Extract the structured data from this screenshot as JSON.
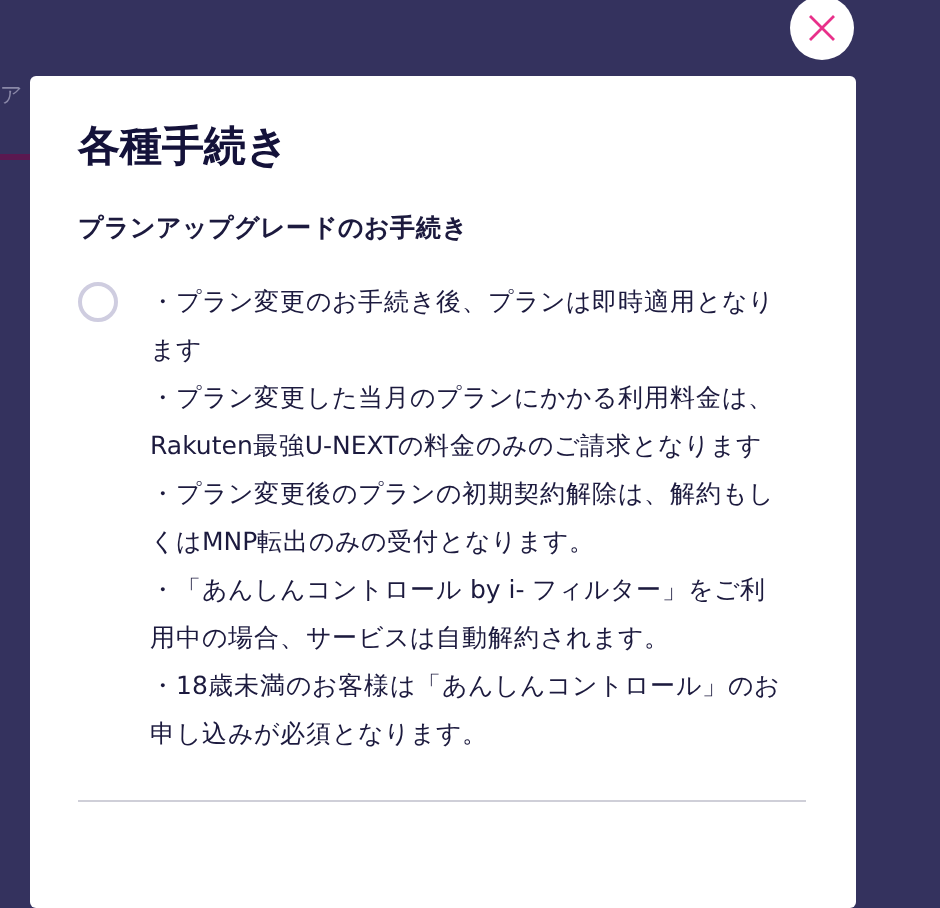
{
  "background": {
    "tab_label": "ア"
  },
  "dialog": {
    "title": "各種手続き",
    "options": [
      {
        "heading": "プランアップグレードのお手続き",
        "selected": false,
        "notes": [
          "・プラン変更のお手続き後、プランは即時適用となります",
          "・プラン変更した当月のプランにかかる利用料金は、Rakuten最強U-NEXTの料金のみのご請求となります",
          "・プラン変更後のプランの初期契約解除は、解約もしくはMNP転出のみの受付となります。",
          "・「あんしんコントロール by i- フィルター」をご利用中の場合、サービスは自動解約されます。",
          "・18歳未満のお客様は「あんしんコントロール」のお申し込みが必須となります。"
        ]
      }
    ]
  }
}
